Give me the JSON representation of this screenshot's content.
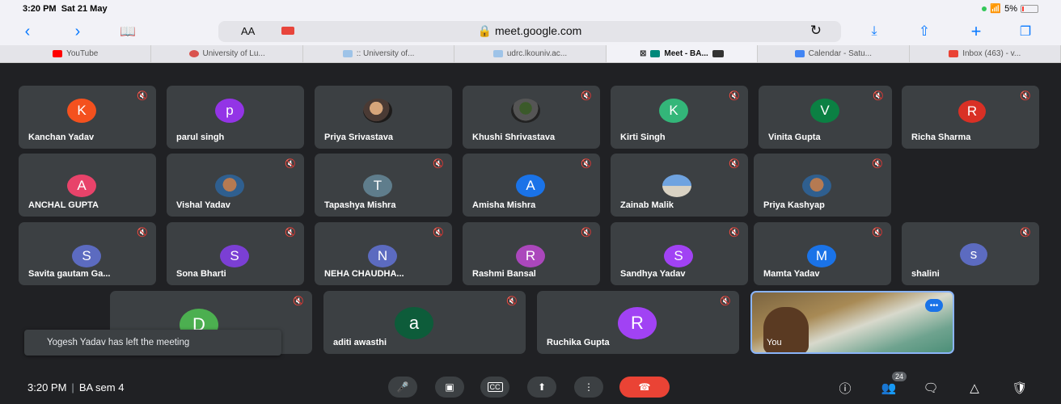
{
  "status": {
    "time": "3:20 PM",
    "date": "Sat 21 May",
    "battery": "5%"
  },
  "toolbar": {
    "aa": "AA",
    "url": "meet.google.com"
  },
  "tabs": [
    {
      "label": "YouTube",
      "color": "#ff0000"
    },
    {
      "label": "University of Lu...",
      "color": "#d9534f"
    },
    {
      "label": ":: University of...",
      "color": "#9ec3e8"
    },
    {
      "label": "udrc.lkouniv.ac...",
      "color": "#9ec3e8"
    },
    {
      "label": "Meet - BA...",
      "color": "#00897b"
    },
    {
      "label": "Calendar - Satu...",
      "color": "#4285f4"
    },
    {
      "label": "Inbox (463) - v...",
      "color": "#ea4335"
    }
  ],
  "participants": [
    {
      "name": "Kanchan Yadav",
      "initial": "K",
      "color": "#f4511e"
    },
    {
      "name": "parul singh",
      "initial": "p",
      "color": "#9334e6"
    },
    {
      "name": "Priya Srivastava",
      "initial": "",
      "color": ""
    },
    {
      "name": "Khushi Shrivastava",
      "initial": "",
      "color": ""
    },
    {
      "name": "Kirti Singh",
      "initial": "K",
      "color": "#33b679"
    },
    {
      "name": "Vinita Gupta",
      "initial": "V",
      "color": "#0b8043"
    },
    {
      "name": "Richa Sharma",
      "initial": "R",
      "color": "#d93025"
    },
    {
      "name": "ANCHAL GUPTA",
      "initial": "A",
      "color": "#e8436a"
    },
    {
      "name": "Vishal Yadav",
      "initial": "",
      "color": ""
    },
    {
      "name": "Tapashya Mishra",
      "initial": "T",
      "color": "#5f7d8c"
    },
    {
      "name": "Amisha Mishra",
      "initial": "A",
      "color": "#1a73e8"
    },
    {
      "name": "Zainab Malik",
      "initial": "",
      "color": ""
    },
    {
      "name": "Priya Kashyap",
      "initial": "",
      "color": ""
    },
    {
      "name": "Savita gautam Ga...",
      "initial": "S",
      "color": "#5c6bc0"
    },
    {
      "name": "Sona Bharti",
      "initial": "S",
      "color": "#7b3fd4"
    },
    {
      "name": "NEHA CHAUDHA...",
      "initial": "N",
      "color": "#5c6bc0"
    },
    {
      "name": "Rashmi Bansal",
      "initial": "R",
      "color": "#ab47bc"
    },
    {
      "name": "Sandhya Yadav",
      "initial": "S",
      "color": "#a142f4"
    },
    {
      "name": "Mamta Yadav",
      "initial": "M",
      "color": "#1a73e8"
    },
    {
      "name": "shalini",
      "initial": "s",
      "color": "#5c6bc0"
    },
    {
      "name": "",
      "initial": "D",
      "color": "#4caf50"
    },
    {
      "name": "aditi awasthi",
      "initial": "a",
      "color": "#0d5c3a"
    },
    {
      "name": "Ruchika Gupta",
      "initial": "R",
      "color": "#a142f4"
    }
  ],
  "self_tile": {
    "name": "You",
    "more": "•••"
  },
  "toast": {
    "text": "Yogesh Yadav has left the meeting"
  },
  "bottom": {
    "time": "3:20 PM",
    "separator": "|",
    "meeting_name": "BA sem 4",
    "participant_count": "24"
  }
}
